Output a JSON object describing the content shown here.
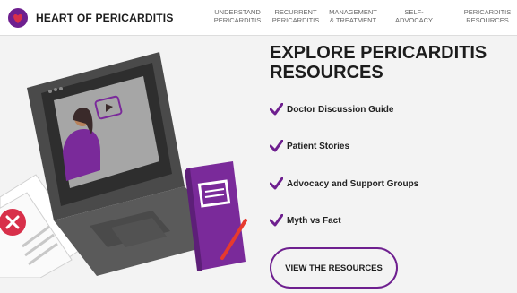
{
  "header": {
    "logo_text": "HEART OF PERICARDITIS",
    "nav": [
      {
        "line1": "UNDERSTAND",
        "line2": "PERICARDITIS"
      },
      {
        "line1": "RECURRENT",
        "line2": "PERICARDITIS"
      },
      {
        "line1": "MANAGEMENT",
        "line2": "& TREATMENT"
      },
      {
        "line1": "SELF-",
        "line2": "ADVOCACY"
      },
      {
        "line1": "PERICARDITIS",
        "line2": "RESOURCES"
      }
    ]
  },
  "main": {
    "title_line1": "EXPLORE PERICARDITIS",
    "title_line2": "RESOURCES",
    "resources": [
      {
        "label": "Doctor Discussion Guide"
      },
      {
        "label": "Patient Stories"
      },
      {
        "label": "Advocacy and Support Groups"
      },
      {
        "label": "Myth vs Fact"
      }
    ],
    "cta_label": "VIEW THE RESOURCES"
  },
  "colors": {
    "accent": "#6e1f8f",
    "logo_red": "#d8304a",
    "laptop": "#4a4a4a",
    "notebook": "#7a2a9a",
    "background": "#f3f3f3"
  },
  "icons": {
    "logo": "heart-logo-icon",
    "check": "purple-checkmark-icon",
    "illustration": "laptop-video-call-illustration"
  }
}
